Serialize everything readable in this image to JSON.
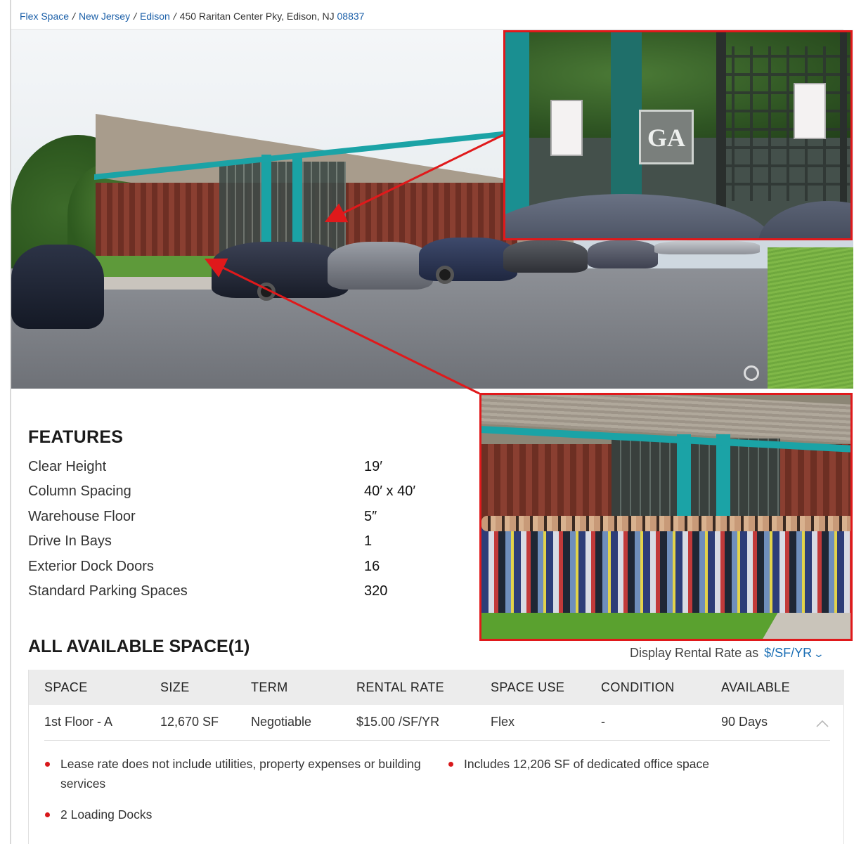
{
  "breadcrumb": {
    "items": [
      "Flex Space",
      "New Jersey",
      "Edison"
    ],
    "address_prefix": "450 Raritan Center Pky, Edison, NJ",
    "zip": "08837",
    "separator": "/"
  },
  "photo": {
    "inset_logo_text": "GA"
  },
  "features": {
    "title": "FEATURES",
    "rows": [
      {
        "label": "Clear Height",
        "value": "19′"
      },
      {
        "label": "Column Spacing",
        "value": "40′ x 40′"
      },
      {
        "label": "Warehouse Floor",
        "value": "5″"
      },
      {
        "label": "Drive In Bays",
        "value": "1"
      },
      {
        "label": "Exterior Dock Doors",
        "value": "16"
      },
      {
        "label": "Standard Parking Spaces",
        "value": "320"
      }
    ]
  },
  "available_space": {
    "title": "ALL AVAILABLE SPACE(1)",
    "rental_rate_label": "Display Rental Rate as",
    "rental_rate_unit": "$/SF/YR",
    "columns": [
      "SPACE",
      "SIZE",
      "TERM",
      "RENTAL RATE",
      "SPACE USE",
      "CONDITION",
      "AVAILABLE"
    ],
    "rows": [
      {
        "space": "1st Floor - A",
        "size": "12,670 SF",
        "term": "Negotiable",
        "rental_rate": "$15.00 /SF/YR",
        "space_use": "Flex",
        "condition": "-",
        "available": "90 Days"
      }
    ],
    "notes": [
      "Lease rate does not include utilities, property expenses or building services",
      "Includes 12,206 SF of dedicated office space",
      "2 Loading Docks"
    ]
  },
  "colors": {
    "link": "#1b5fa8",
    "accent_red": "#e0191b",
    "header_bg": "#ececec"
  }
}
